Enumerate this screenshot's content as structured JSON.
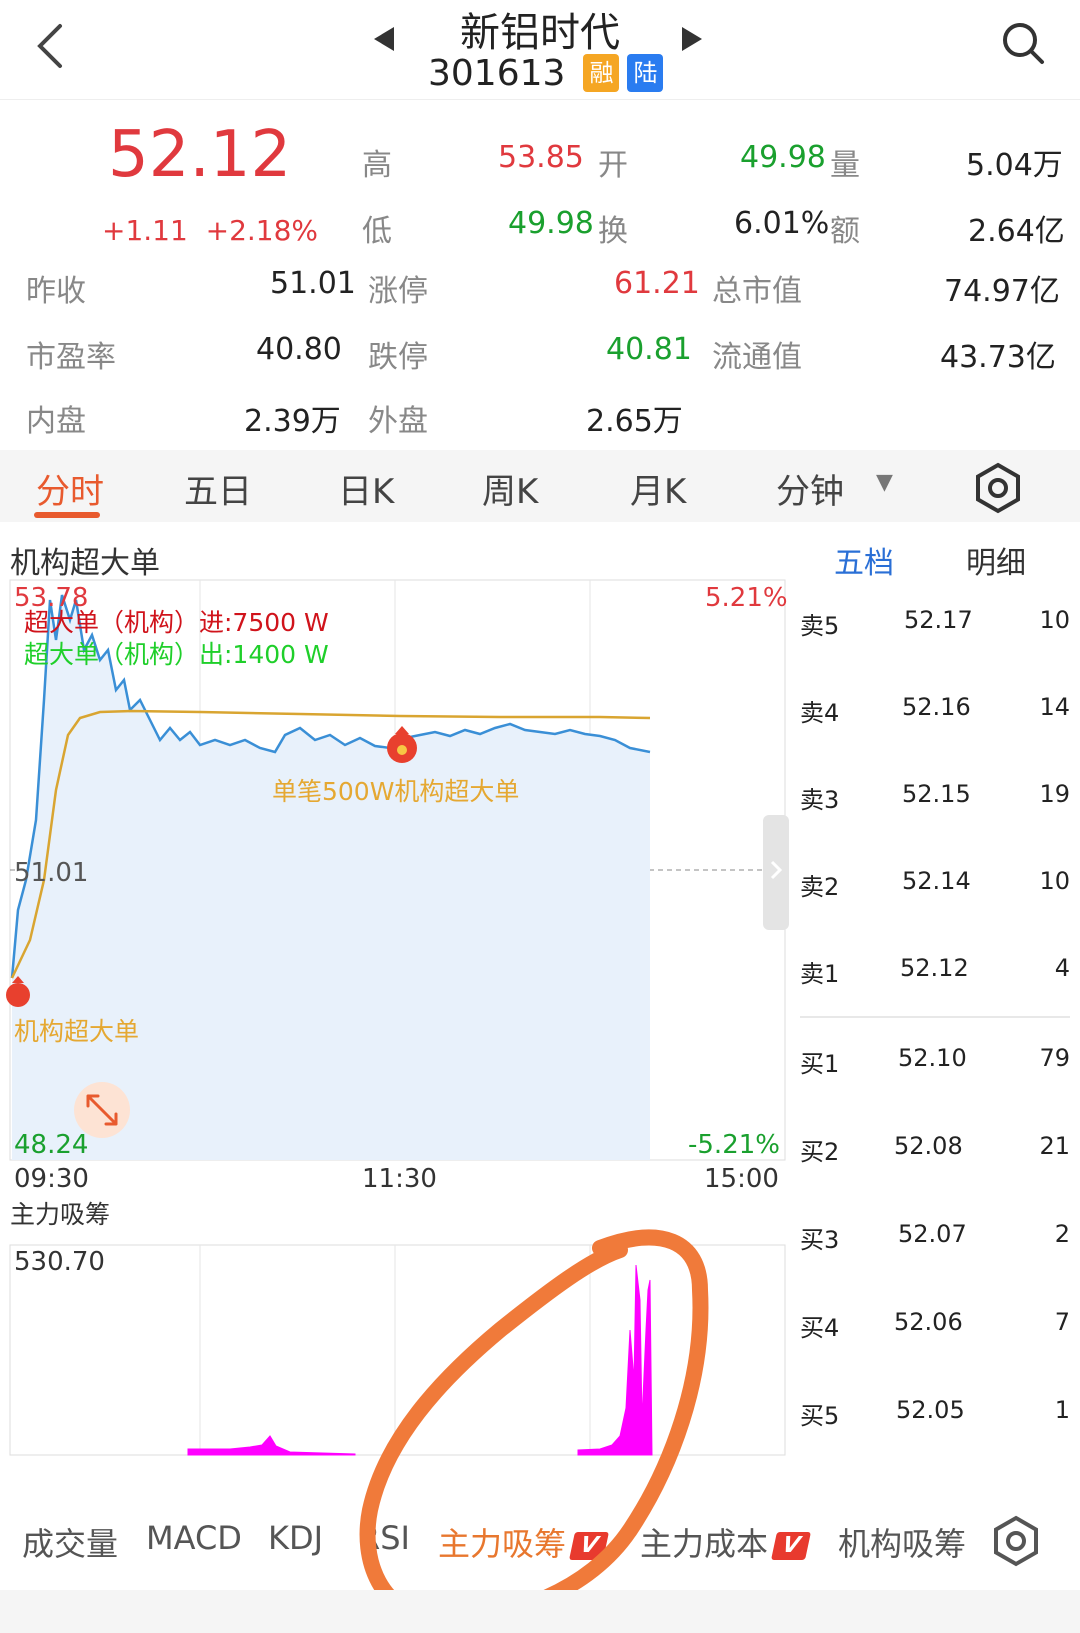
{
  "header": {
    "stock_name": "新铝时代",
    "stock_code": "301613",
    "tag_margin": "融",
    "tag_connect": "陆"
  },
  "quote": {
    "price": "52.12",
    "change": "+1.11",
    "change_pct": "+2.18%",
    "high_label": "高",
    "high": "53.85",
    "open_label": "开",
    "open": "49.98",
    "volume_label": "量",
    "volume": "5.04万",
    "low_label": "低",
    "low": "49.98",
    "turnover_label": "换",
    "turnover": "6.01%",
    "amount_label": "额",
    "amount": "2.64亿",
    "prev_close_label": "昨收",
    "prev_close": "51.01",
    "limit_up_label": "涨停",
    "limit_up": "61.21",
    "market_cap_label": "总市值",
    "market_cap": "74.97亿",
    "pe_label": "市盈率",
    "pe": "40.80",
    "limit_down_label": "跌停",
    "limit_down": "40.81",
    "float_cap_label": "流通值",
    "float_cap": "43.73亿",
    "inner_label": "内盘",
    "inner": "2.39万",
    "outer_label": "外盘",
    "outer": "2.65万"
  },
  "tabs": [
    "分时",
    "五日",
    "日K",
    "周K",
    "月K",
    "分钟"
  ],
  "chart": {
    "title": "机构超大单",
    "y_top": "53.78",
    "y_mid": "51.01",
    "y_bottom": "48.24",
    "pct_top": "5.21%",
    "pct_bottom": "-5.21%",
    "legend_in": "超大单（机构）进:7500 W",
    "legend_out": "超大单（机构）出:1400 W",
    "annotation_mid": "单笔500W机构超大单",
    "annotation_left": "机构超大单",
    "x_start": "09:30",
    "x_mid": "11:30",
    "x_end": "15:00",
    "sub_title": "主力吸筹",
    "sub_max": "530.70"
  },
  "order_book": {
    "tab_five": "五档",
    "tab_detail": "明细",
    "asks": [
      {
        "label": "卖5",
        "price": "52.17",
        "vol": "10"
      },
      {
        "label": "卖4",
        "price": "52.16",
        "vol": "14"
      },
      {
        "label": "卖3",
        "price": "52.15",
        "vol": "19"
      },
      {
        "label": "卖2",
        "price": "52.14",
        "vol": "10"
      },
      {
        "label": "卖1",
        "price": "52.12",
        "vol": "4"
      }
    ],
    "bids": [
      {
        "label": "买1",
        "price": "52.10",
        "vol": "79"
      },
      {
        "label": "买2",
        "price": "52.08",
        "vol": "21"
      },
      {
        "label": "买3",
        "price": "52.07",
        "vol": "2"
      },
      {
        "label": "买4",
        "price": "52.06",
        "vol": "7"
      },
      {
        "label": "买5",
        "price": "52.05",
        "vol": "1"
      }
    ]
  },
  "indicator_tabs": [
    "成交量",
    "MACD",
    "KDJ",
    "RSI",
    "主力吸筹",
    "主力成本",
    "机构吸筹"
  ],
  "vip_badge": "V",
  "colors": {
    "up": "#e0393e",
    "down": "#1aa02e",
    "price_line": "#3a8fd6",
    "avg_line": "#d9a531",
    "accent": "#e85a2e",
    "volume_bar": "#ff00ff"
  }
}
